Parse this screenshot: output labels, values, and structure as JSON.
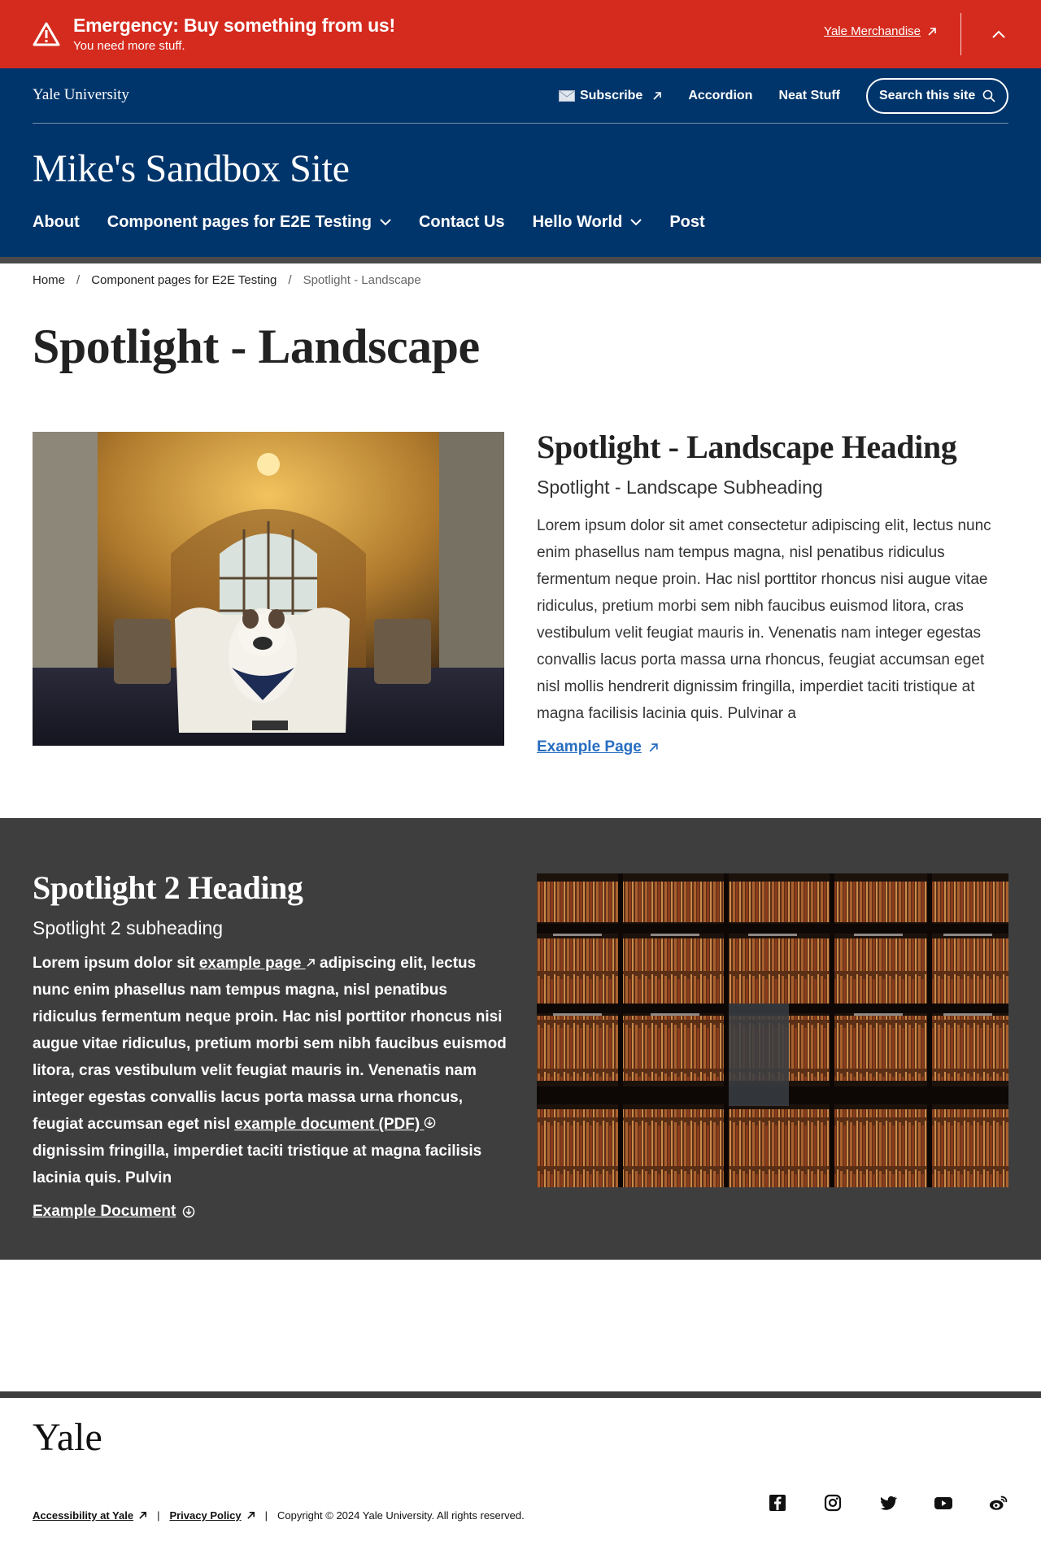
{
  "alert": {
    "title": "Emergency: Buy something from us!",
    "description": "You need more stuff.",
    "link_label": "Yale Merchandise"
  },
  "header": {
    "wordmark": "Yale University",
    "utility": {
      "subscribe": "Subscribe",
      "accordion": "Accordion",
      "neat_stuff": "Neat Stuff",
      "search_placeholder": "Search this site"
    },
    "site_title": "Mike's Sandbox Site",
    "nav": {
      "about": "About",
      "components": "Component pages for E2E Testing",
      "contact": "Contact Us",
      "hello": "Hello World",
      "post": "Post"
    }
  },
  "breadcrumb": {
    "home": "Home",
    "parent": "Component pages for E2E Testing",
    "current": "Spotlight - Landscape"
  },
  "page_title": "Spotlight - Landscape",
  "spotlight1": {
    "heading": "Spotlight - Landscape Heading",
    "subheading": "Spotlight - Landscape Subheading",
    "body": "Lorem ipsum dolor sit amet consectetur adipiscing elit, lectus nunc enim phasellus nam tempus magna, nisl penatibus ridiculus fermentum neque proin. Hac nisl porttitor rhoncus nisi augue vitae ridiculus, pretium morbi sem nibh faucibus euismod litora, cras vestibulum velit feugiat mauris in. Venenatis nam integer egestas convallis lacus porta massa urna rhoncus, feugiat accumsan eget nisl mollis hendrerit dignissim fringilla, imperdiet taciti tristique at magna facilisis lacinia quis. Pulvinar a",
    "link_label": "Example Page"
  },
  "spotlight2": {
    "heading": "Spotlight 2 Heading",
    "subheading": "Spotlight 2 subheading",
    "body_part1": "Lorem ipsum dolor sit ",
    "inline_link1": "example page",
    "body_part2": " adipiscing elit, lectus nunc enim phasellus nam tempus magna, nisl penatibus ridiculus fermentum neque proin. Hac nisl porttitor rhoncus nisi augue vitae ridiculus, pretium morbi sem nibh faucibus euismod litora, cras vestibulum velit feugiat mauris in. Venenatis nam integer egestas convallis lacus porta massa urna rhoncus, feugiat accumsan eget nisl ",
    "inline_link2": "example document (PDF)",
    "body_part3": " dignissim fringilla, imperdiet taciti tristique at magna facilisis lacinia quis. Pulvin",
    "link_label": "Example Document"
  },
  "footer": {
    "logo": "Yale",
    "accessibility": "Accessibility at Yale",
    "privacy": "Privacy Policy",
    "copyright": "Copyright © 2024 Yale University. All rights reserved.",
    "social_icons": [
      "facebook-icon",
      "instagram-icon",
      "twitter-icon",
      "youtube-icon",
      "weibo-icon"
    ]
  },
  "colors": {
    "alert_red": "#d52b1e",
    "yale_blue": "#00356b",
    "link_blue": "#286dc0",
    "dark_gray": "#3e3e3e"
  }
}
